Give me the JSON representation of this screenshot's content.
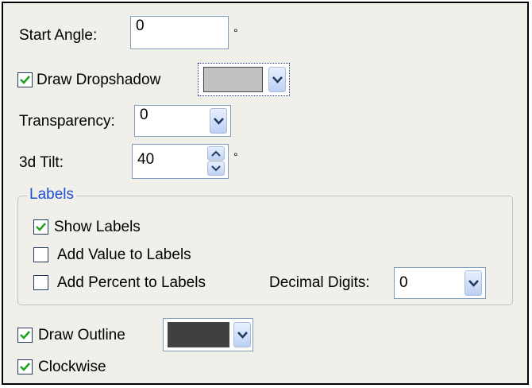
{
  "start_angle": {
    "label": "Start Angle:",
    "value": "0",
    "unit": "°"
  },
  "draw_dropshadow": {
    "label": "Draw Dropshadow",
    "checked": true,
    "color": "#c0c0c0",
    "icon": "chevron-down-icon"
  },
  "transparency": {
    "label": "Transparency:",
    "value": "0",
    "icon": "chevron-down-icon"
  },
  "tilt": {
    "label": "3d Tilt:",
    "value": "40",
    "unit": "°",
    "icons": [
      "spin-up-icon",
      "spin-down-icon"
    ]
  },
  "labels_group": {
    "title": "Labels",
    "show_labels": {
      "label": "Show Labels",
      "checked": true
    },
    "add_value": {
      "label": "Add Value to Labels",
      "checked": false
    },
    "add_percent": {
      "label": "Add Percent to Labels",
      "checked": false
    },
    "decimal_digits": {
      "label": "Decimal Digits:",
      "value": "0",
      "icon": "chevron-down-icon"
    }
  },
  "draw_outline": {
    "label": "Draw Outline",
    "checked": true,
    "color": "#404040",
    "icon": "chevron-down-icon"
  },
  "clockwise": {
    "label": "Clockwise",
    "checked": true
  },
  "colors": {
    "accent": "#1e4fd6",
    "check": "#21a121",
    "panel": "#f0efe9",
    "border": "#7f9db9"
  }
}
